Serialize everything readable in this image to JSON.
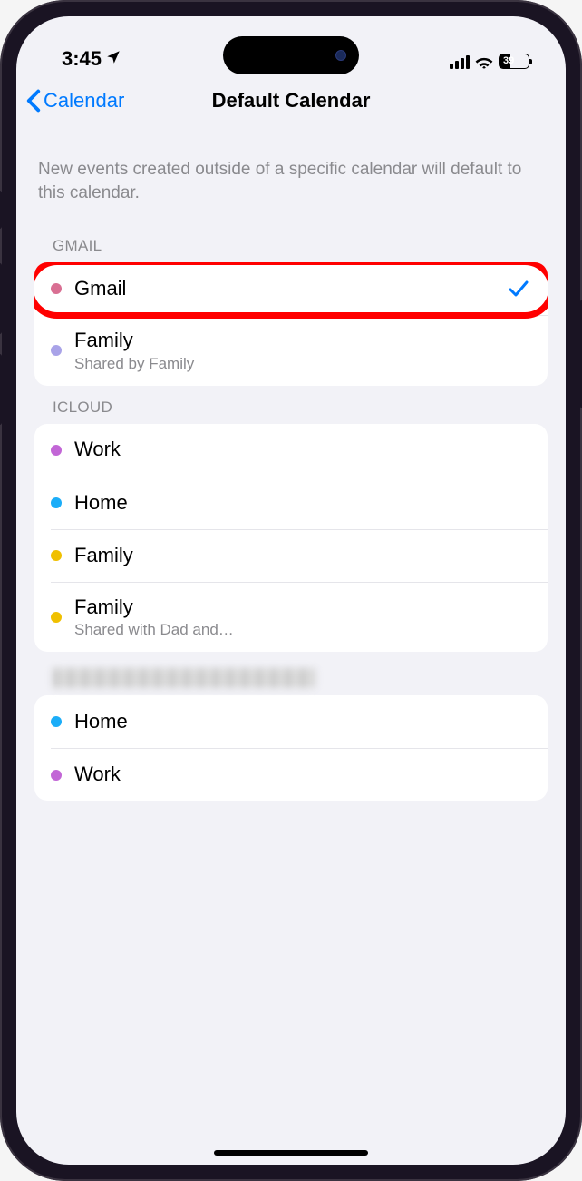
{
  "status_bar": {
    "time": "3:45",
    "battery_percent": "39"
  },
  "nav": {
    "back_label": "Calendar",
    "title": "Default Calendar"
  },
  "description": "New events created outside of a specific calendar will default to this calendar.",
  "sections": [
    {
      "header": "GMAIL",
      "blurred": false,
      "items": [
        {
          "label": "Gmail",
          "sub": "",
          "color": "#d96f93",
          "checked": true,
          "highlight": true
        },
        {
          "label": "Family",
          "sub": "Shared by Family",
          "color": "#a9a3e8",
          "checked": false,
          "highlight": false
        }
      ]
    },
    {
      "header": "ICLOUD",
      "blurred": false,
      "items": [
        {
          "label": "Work",
          "sub": "",
          "color": "#c266d6",
          "checked": false,
          "highlight": false
        },
        {
          "label": "Home",
          "sub": "",
          "color": "#1badf8",
          "checked": false,
          "highlight": false
        },
        {
          "label": "Family",
          "sub": "",
          "color": "#f0c000",
          "checked": false,
          "highlight": false
        },
        {
          "label": "Family",
          "sub": "Shared with Dad and…",
          "color": "#f0c000",
          "checked": false,
          "highlight": false
        }
      ]
    },
    {
      "header": "",
      "blurred": true,
      "items": [
        {
          "label": "Home",
          "sub": "",
          "color": "#1badf8",
          "checked": false,
          "highlight": false
        },
        {
          "label": "Work",
          "sub": "",
          "color": "#c266d6",
          "checked": false,
          "highlight": false
        }
      ]
    }
  ],
  "colors": {
    "ios_blue": "#007aff",
    "highlight_red": "#ff0000",
    "bg": "#f2f2f7"
  }
}
